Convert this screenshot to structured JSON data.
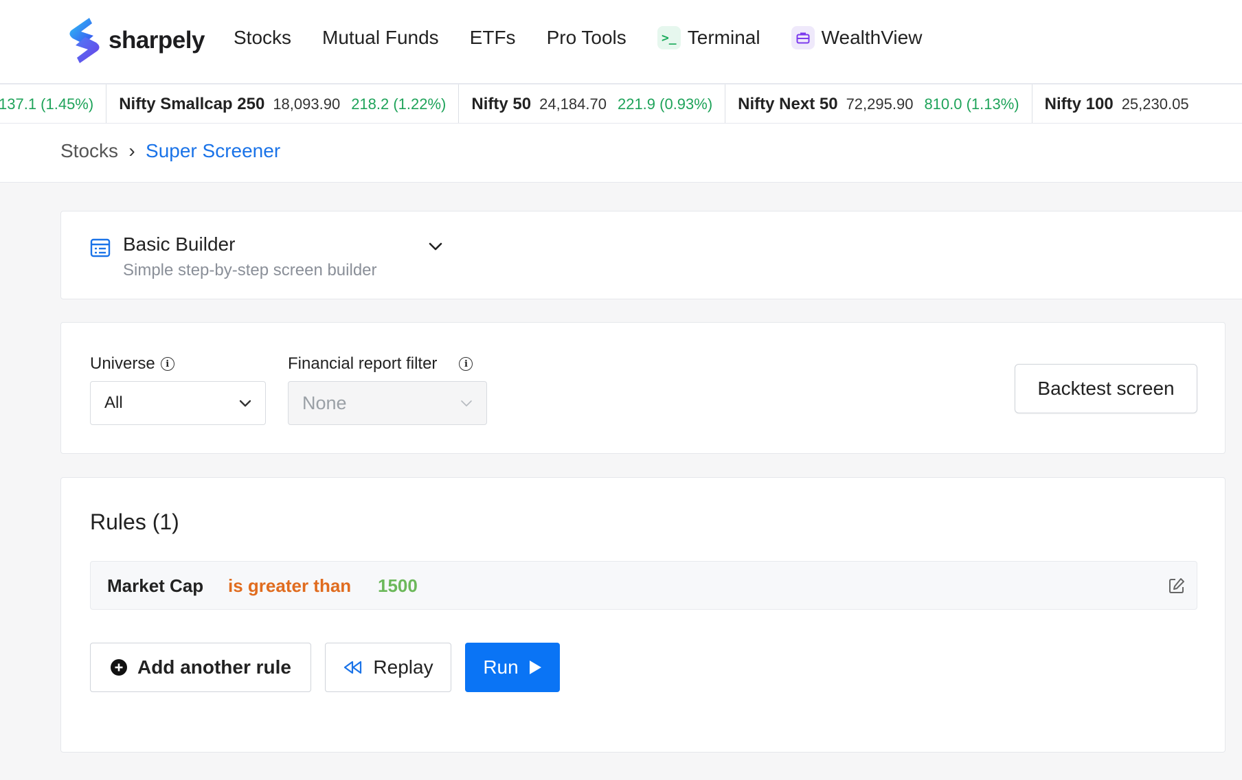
{
  "brand": {
    "name": "sharpely"
  },
  "nav": {
    "items": [
      {
        "label": "Stocks"
      },
      {
        "label": "Mutual Funds"
      },
      {
        "label": "ETFs"
      },
      {
        "label": "Pro Tools"
      },
      {
        "label": "Terminal",
        "icon": "terminal-icon"
      },
      {
        "label": "WealthView",
        "icon": "briefcase-icon"
      }
    ]
  },
  "ticker": [
    {
      "name": "",
      "value": "",
      "change": "137.1 (1.45%)"
    },
    {
      "name": "Nifty Smallcap 250",
      "value": "18,093.90",
      "change": "218.2 (1.22%)"
    },
    {
      "name": "Nifty 50",
      "value": "24,184.70",
      "change": "221.9 (0.93%)"
    },
    {
      "name": "Nifty Next 50",
      "value": "72,295.90",
      "change": "810.0 (1.13%)"
    },
    {
      "name": "Nifty 100",
      "value": "25,230.05",
      "change": ""
    }
  ],
  "breadcrumb": {
    "parent": "Stocks",
    "separator": "›",
    "current": "Super Screener"
  },
  "builder": {
    "title": "Basic Builder",
    "subtitle": "Simple step-by-step screen builder"
  },
  "filters": {
    "universe_label": "Universe",
    "universe_value": "All",
    "report_label": "Financial report filter",
    "report_value": "None",
    "backtest_label": "Backtest screen"
  },
  "rules": {
    "title": "Rules (1)",
    "items": [
      {
        "field": "Market Cap",
        "operator": "is greater than",
        "value": "1500"
      }
    ],
    "add_label": "Add another rule",
    "replay_label": "Replay",
    "run_label": "Run"
  },
  "colors": {
    "accent": "#0a74f5",
    "positive": "#1fa35a",
    "operator": "#e06c1f",
    "value": "#6cb85a"
  }
}
